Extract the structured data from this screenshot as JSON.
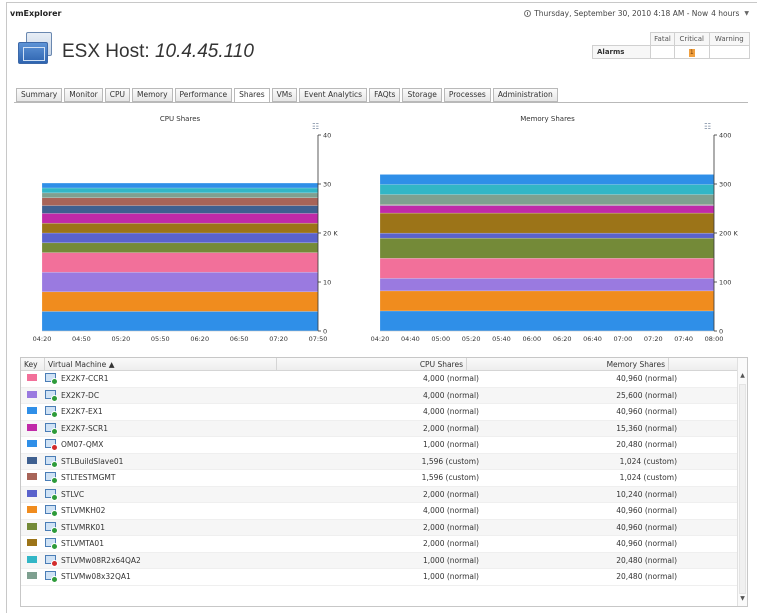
{
  "app": {
    "title": "vmExplorer"
  },
  "topbar": {
    "datetime": "Thursday, September 30, 2010 4:18 AM - Now",
    "range": "4 hours"
  },
  "host": {
    "label": "ESX Host:",
    "ip": "10.4.45.110"
  },
  "alarms": {
    "label": "Alarms",
    "columns": [
      "Fatal",
      "Critical",
      "Warning"
    ],
    "critical_count": "1",
    "colors": {
      "critical": "#f0a040"
    }
  },
  "tabs": [
    "Summary",
    "Monitor",
    "CPU",
    "Memory",
    "Performance",
    "Shares",
    "VMs",
    "Event Analytics",
    "FAQts",
    "Storage",
    "Processes",
    "Administration"
  ],
  "active_tab": "Shares",
  "grid": {
    "columns": {
      "key": "Key",
      "vm": "Virtual Machine",
      "sort_indicator": "▲",
      "cpu": "CPU Shares",
      "mem": "Memory Shares"
    },
    "rows": [
      {
        "color": "#f2709a",
        "name": "EX2K7-CCR1",
        "status": "ok",
        "cpu": "4,000 (normal)",
        "mem": "40,960 (normal)"
      },
      {
        "color": "#9a7ae0",
        "name": "EX2K7-DC",
        "status": "ok",
        "cpu": "4,000 (normal)",
        "mem": "25,600 (normal)"
      },
      {
        "color": "#2f8fe8",
        "name": "EX2K7-EX1",
        "status": "ok",
        "cpu": "4,000 (normal)",
        "mem": "40,960 (normal)"
      },
      {
        "color": "#c02aa8",
        "name": "EX2K7-SCR1",
        "status": "ok",
        "cpu": "2,000 (normal)",
        "mem": "15,360 (normal)"
      },
      {
        "color": "#2f8fe8",
        "name": "OM07-QMX",
        "status": "err",
        "cpu": "1,000 (normal)",
        "mem": "20,480 (normal)"
      },
      {
        "color": "#3f6090",
        "name": "STLBuildSlave01",
        "status": "ok",
        "cpu": "1,596 (custom)",
        "mem": "1,024 (custom)"
      },
      {
        "color": "#a86458",
        "name": "STLTESTMGMT",
        "status": "ok",
        "cpu": "1,596 (custom)",
        "mem": "1,024 (custom)"
      },
      {
        "color": "#5a62cc",
        "name": "STLVC",
        "status": "ok",
        "cpu": "2,000 (normal)",
        "mem": "10,240 (normal)"
      },
      {
        "color": "#f08c1e",
        "name": "STLVMKH02",
        "status": "ok",
        "cpu": "4,000 (normal)",
        "mem": "40,960 (normal)"
      },
      {
        "color": "#748a38",
        "name": "STLVMRK01",
        "status": "ok",
        "cpu": "2,000 (normal)",
        "mem": "40,960 (normal)"
      },
      {
        "color": "#9c7418",
        "name": "STLVMTA01",
        "status": "ok",
        "cpu": "2,000 (normal)",
        "mem": "40,960 (normal)"
      },
      {
        "color": "#32b6c6",
        "name": "STLVMw08R2x64QA2",
        "status": "err",
        "cpu": "1,000 (normal)",
        "mem": "20,480 (normal)"
      },
      {
        "color": "#7ea090",
        "name": "STLVMw08x32QA1",
        "status": "ok",
        "cpu": "1,000 (normal)",
        "mem": "20,480 (normal)"
      }
    ]
  },
  "chart_data": [
    {
      "type": "area",
      "title": "CPU Shares",
      "x": [
        "04:20",
        "04:50",
        "05:20",
        "05:50",
        "06:20",
        "06:50",
        "07:20",
        "07:50"
      ],
      "y_tick_labels": [
        "0",
        "10",
        "20 K",
        "30",
        "40"
      ],
      "ylim": [
        0,
        40000
      ],
      "stacked": true,
      "grid": false,
      "series": [
        {
          "vm": "EX2K7-EX1",
          "color": "#2f8fe8",
          "value": 4000
        },
        {
          "vm": "STLVMKH02",
          "color": "#f08c1e",
          "value": 4000
        },
        {
          "vm": "EX2K7-DC",
          "color": "#9a7ae0",
          "value": 4000
        },
        {
          "vm": "EX2K7-CCR1",
          "color": "#f2709a",
          "value": 4000
        },
        {
          "vm": "STLVMRK01",
          "color": "#748a38",
          "value": 2000
        },
        {
          "vm": "STLVC",
          "color": "#5a62cc",
          "value": 2000
        },
        {
          "vm": "STLVMTA01",
          "color": "#9c7418",
          "value": 2000
        },
        {
          "vm": "EX2K7-SCR1",
          "color": "#c02aa8",
          "value": 2000
        },
        {
          "vm": "STLBuildSlave01",
          "color": "#3f6090",
          "value": 1596
        },
        {
          "vm": "STLTESTMGMT",
          "color": "#a86458",
          "value": 1596
        },
        {
          "vm": "STLVMw08x32QA1",
          "color": "#7ea090",
          "value": 1000
        },
        {
          "vm": "STLVMw08R2x64QA2",
          "color": "#32b6c6",
          "value": 1000
        },
        {
          "vm": "OM07-QMX",
          "color": "#2f8fe8",
          "value": 1000
        }
      ]
    },
    {
      "type": "area",
      "title": "Memory Shares",
      "x": [
        "04:20",
        "04:40",
        "05:00",
        "05:20",
        "05:40",
        "06:00",
        "06:20",
        "06:40",
        "07:00",
        "07:20",
        "07:40",
        "08:00"
      ],
      "y_tick_labels": [
        "0",
        "100",
        "200 K",
        "300",
        "400"
      ],
      "ylim": [
        0,
        400000
      ],
      "stacked": true,
      "grid": false,
      "series": [
        {
          "vm": "EX2K7-EX1",
          "color": "#2f8fe8",
          "value": 40960
        },
        {
          "vm": "STLVMKH02",
          "color": "#f08c1e",
          "value": 40960
        },
        {
          "vm": "EX2K7-DC",
          "color": "#9a7ae0",
          "value": 25600
        },
        {
          "vm": "EX2K7-CCR1",
          "color": "#f2709a",
          "value": 40960
        },
        {
          "vm": "STLVMRK01",
          "color": "#748a38",
          "value": 40960
        },
        {
          "vm": "STLVC",
          "color": "#5a62cc",
          "value": 10240
        },
        {
          "vm": "STLVMTA01",
          "color": "#9c7418",
          "value": 40960
        },
        {
          "vm": "EX2K7-SCR1",
          "color": "#c02aa8",
          "value": 15360
        },
        {
          "vm": "STLBuildSlave01",
          "color": "#3f6090",
          "value": 1024
        },
        {
          "vm": "STLTESTMGMT",
          "color": "#a86458",
          "value": 1024
        },
        {
          "vm": "STLVMw08x32QA1",
          "color": "#7ea090",
          "value": 20480
        },
        {
          "vm": "STLVMw08R2x64QA2",
          "color": "#32b6c6",
          "value": 20480
        },
        {
          "vm": "OM07-QMX",
          "color": "#2f8fe8",
          "value": 20480
        }
      ]
    }
  ]
}
